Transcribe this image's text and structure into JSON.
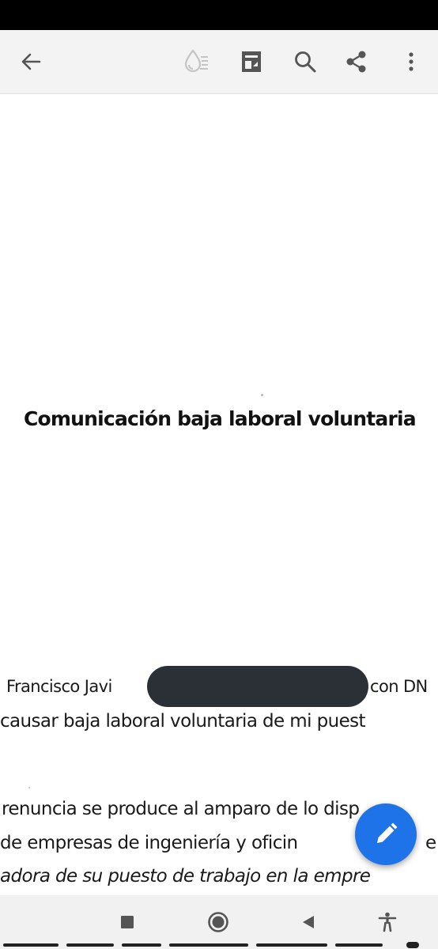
{
  "toolbar": {
    "icons": [
      "back-arrow-icon",
      "ink-saver-icon",
      "page-layout-icon",
      "search-icon",
      "share-icon",
      "more-vert-icon"
    ]
  },
  "document": {
    "title": "Comunicación baja laboral voluntaria",
    "lines": [
      "Francisco Javi",
      "con DN",
      "causar baja laboral voluntaria de mi puest",
      "renuncia se produce al amparo de lo disp",
      "de empresas de ingeniería y oficin",
      "e",
      "adora de su puesto de trabajo en la empre"
    ]
  },
  "fab": {
    "icon": "pencil-edit-icon",
    "color": "#1e73e8"
  },
  "nav": {
    "icons": [
      "recents-square-icon",
      "home-circle-icon",
      "back-triangle-icon",
      "accessibility-icon"
    ]
  },
  "colors": {
    "toolbar_bg": "#f3f3f3",
    "icon_color": "#555555",
    "redaction": "#2b3036"
  }
}
